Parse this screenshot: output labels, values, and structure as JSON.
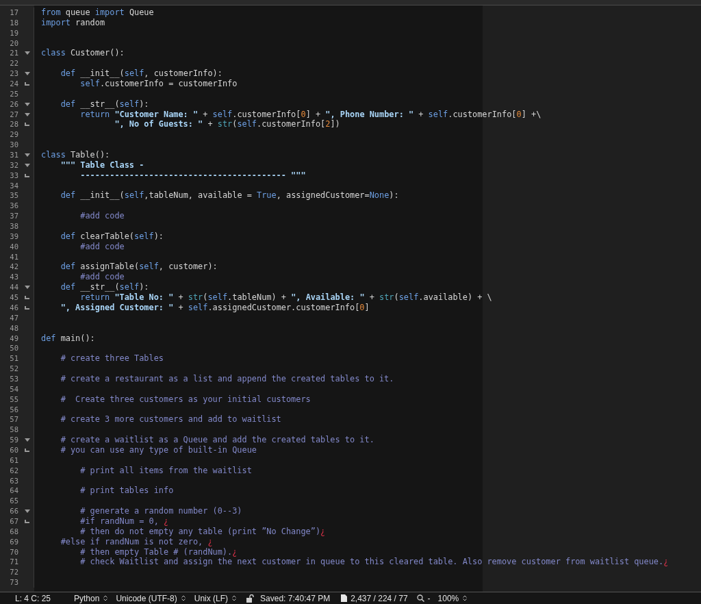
{
  "editor": {
    "lines": [
      {
        "number": "17",
        "tokens": [
          {
            "kind": "keyword",
            "text": "from"
          },
          {
            "kind": "text",
            "text": " queue "
          },
          {
            "kind": "keyword",
            "text": "import"
          },
          {
            "kind": "text",
            "text": " Queue"
          }
        ]
      },
      {
        "number": "18",
        "tokens": [
          {
            "kind": "keyword",
            "text": "import"
          },
          {
            "kind": "text",
            "text": " random"
          }
        ]
      },
      {
        "number": "19"
      },
      {
        "number": "20"
      },
      {
        "number": "21",
        "foldable": true,
        "tokens": [
          {
            "kind": "keyword",
            "text": "class"
          },
          {
            "kind": "text",
            "text": " Customer():"
          }
        ]
      },
      {
        "number": "22"
      },
      {
        "number": "23",
        "foldable": true,
        "tokens": [
          {
            "kind": "keyword",
            "text": "    def"
          },
          {
            "kind": "text",
            "text": " __init__("
          },
          {
            "kind": "keyword",
            "text": "self"
          },
          {
            "kind": "text",
            "text": ", customerInfo):"
          }
        ]
      },
      {
        "number": "24",
        "fold_end": true,
        "tokens": [
          {
            "kind": "keyword",
            "text": "        self"
          },
          {
            "kind": "text",
            "text": ".customerInfo = customerInfo"
          }
        ]
      },
      {
        "number": "25"
      },
      {
        "number": "26",
        "foldable": true,
        "tokens": [
          {
            "kind": "keyword",
            "text": "    def"
          },
          {
            "kind": "text",
            "text": " __str__("
          },
          {
            "kind": "keyword",
            "text": "self"
          },
          {
            "kind": "text",
            "text": "):"
          }
        ]
      },
      {
        "number": "27",
        "foldable": true,
        "tokens": [
          {
            "kind": "keyword",
            "text": "        return "
          },
          {
            "kind": "string",
            "text": "\"Customer Name: \""
          },
          {
            "kind": "text",
            "text": " + "
          },
          {
            "kind": "keyword",
            "text": "self"
          },
          {
            "kind": "text",
            "text": ".customerInfo["
          },
          {
            "kind": "number",
            "text": "0"
          },
          {
            "kind": "text",
            "text": "] + "
          },
          {
            "kind": "string",
            "text": "\", Phone Number: \""
          },
          {
            "kind": "text",
            "text": " + "
          },
          {
            "kind": "keyword",
            "text": "self"
          },
          {
            "kind": "text",
            "text": ".customerInfo["
          },
          {
            "kind": "number",
            "text": "0"
          },
          {
            "kind": "text",
            "text": "] +\\"
          }
        ]
      },
      {
        "number": "28",
        "fold_end": true,
        "tokens": [
          {
            "kind": "string",
            "text": "               \", No of Guests: \""
          },
          {
            "kind": "text",
            "text": " + "
          },
          {
            "kind": "builtin",
            "text": "str"
          },
          {
            "kind": "text",
            "text": "("
          },
          {
            "kind": "keyword",
            "text": "self"
          },
          {
            "kind": "text",
            "text": ".customerInfo["
          },
          {
            "kind": "number",
            "text": "2"
          },
          {
            "kind": "text",
            "text": "])"
          }
        ]
      },
      {
        "number": "29"
      },
      {
        "number": "30"
      },
      {
        "number": "31",
        "foldable": true,
        "tokens": [
          {
            "kind": "keyword",
            "text": "class"
          },
          {
            "kind": "text",
            "text": " Table():"
          }
        ]
      },
      {
        "number": "32",
        "foldable": true,
        "tokens": [
          {
            "kind": "string",
            "text": "    \"\"\" Table Class -"
          }
        ]
      },
      {
        "number": "33",
        "fold_end": true,
        "tokens": [
          {
            "kind": "string",
            "text": "        ------------------------------------------ \"\"\""
          }
        ]
      },
      {
        "number": "34"
      },
      {
        "number": "35",
        "tokens": [
          {
            "kind": "keyword",
            "text": "    def"
          },
          {
            "kind": "text",
            "text": " __init__("
          },
          {
            "kind": "keyword",
            "text": "self"
          },
          {
            "kind": "text",
            "text": ",tableNum, available = "
          },
          {
            "kind": "keyword",
            "text": "True"
          },
          {
            "kind": "text",
            "text": ", assignedCustomer="
          },
          {
            "kind": "keyword",
            "text": "None"
          },
          {
            "kind": "text",
            "text": "):"
          }
        ]
      },
      {
        "number": "36"
      },
      {
        "number": "37",
        "tokens": [
          {
            "kind": "comment",
            "text": "        #add code"
          }
        ]
      },
      {
        "number": "38"
      },
      {
        "number": "39",
        "tokens": [
          {
            "kind": "keyword",
            "text": "    def"
          },
          {
            "kind": "text",
            "text": " clearTable("
          },
          {
            "kind": "keyword",
            "text": "self"
          },
          {
            "kind": "text",
            "text": "):"
          }
        ]
      },
      {
        "number": "40",
        "tokens": [
          {
            "kind": "comment",
            "text": "        #add code"
          }
        ]
      },
      {
        "number": "41"
      },
      {
        "number": "42",
        "tokens": [
          {
            "kind": "keyword",
            "text": "    def"
          },
          {
            "kind": "text",
            "text": " assignTable("
          },
          {
            "kind": "keyword",
            "text": "self"
          },
          {
            "kind": "text",
            "text": ", customer):"
          }
        ]
      },
      {
        "number": "43",
        "tokens": [
          {
            "kind": "comment",
            "text": "        #add code"
          }
        ]
      },
      {
        "number": "44",
        "foldable": true,
        "tokens": [
          {
            "kind": "keyword",
            "text": "    def"
          },
          {
            "kind": "text",
            "text": " __str__("
          },
          {
            "kind": "keyword",
            "text": "self"
          },
          {
            "kind": "text",
            "text": "):"
          }
        ]
      },
      {
        "number": "45",
        "fold_end": true,
        "tokens": [
          {
            "kind": "keyword",
            "text": "        return "
          },
          {
            "kind": "string",
            "text": "\"Table No: \""
          },
          {
            "kind": "text",
            "text": " + "
          },
          {
            "kind": "builtin",
            "text": "str"
          },
          {
            "kind": "text",
            "text": "("
          },
          {
            "kind": "keyword",
            "text": "self"
          },
          {
            "kind": "text",
            "text": ".tableNum) + "
          },
          {
            "kind": "string",
            "text": "\", Available: \""
          },
          {
            "kind": "text",
            "text": " + "
          },
          {
            "kind": "builtin",
            "text": "str"
          },
          {
            "kind": "text",
            "text": "("
          },
          {
            "kind": "keyword",
            "text": "self"
          },
          {
            "kind": "text",
            "text": ".available) + \\"
          }
        ]
      },
      {
        "number": "46",
        "fold_end": true,
        "tokens": [
          {
            "kind": "string",
            "text": "    \", Assigned Customer: \""
          },
          {
            "kind": "text",
            "text": " + "
          },
          {
            "kind": "keyword",
            "text": "self"
          },
          {
            "kind": "text",
            "text": ".assignedCustomer.customerInfo["
          },
          {
            "kind": "number",
            "text": "0"
          },
          {
            "kind": "text",
            "text": "]"
          }
        ]
      },
      {
        "number": "47"
      },
      {
        "number": "48"
      },
      {
        "number": "49",
        "tokens": [
          {
            "kind": "keyword",
            "text": "def"
          },
          {
            "kind": "text",
            "text": " main():"
          }
        ]
      },
      {
        "number": "50"
      },
      {
        "number": "51",
        "tokens": [
          {
            "kind": "comment",
            "text": "    # create three Tables"
          }
        ]
      },
      {
        "number": "52"
      },
      {
        "number": "53",
        "tokens": [
          {
            "kind": "comment",
            "text": "    # create a restaurant as a list and append the created tables to it."
          }
        ]
      },
      {
        "number": "54"
      },
      {
        "number": "55",
        "tokens": [
          {
            "kind": "comment",
            "text": "    #  Create three customers as your initial customers"
          }
        ]
      },
      {
        "number": "56"
      },
      {
        "number": "57",
        "tokens": [
          {
            "kind": "comment",
            "text": "    # create 3 more customers and add to waitlist"
          }
        ]
      },
      {
        "number": "58"
      },
      {
        "number": "59",
        "foldable": true,
        "tokens": [
          {
            "kind": "comment",
            "text": "    # create a waitlist as a Queue and add the created tables to it."
          }
        ]
      },
      {
        "number": "60",
        "fold_end": true,
        "tokens": [
          {
            "kind": "comment",
            "text": "    # you can use any type of built-in Queue"
          }
        ]
      },
      {
        "number": "61"
      },
      {
        "number": "62",
        "tokens": [
          {
            "kind": "comment",
            "text": "        # print all items from the waitlist"
          }
        ]
      },
      {
        "number": "63"
      },
      {
        "number": "64",
        "tokens": [
          {
            "kind": "comment",
            "text": "        # print tables info"
          }
        ]
      },
      {
        "number": "65"
      },
      {
        "number": "66",
        "foldable": true,
        "tokens": [
          {
            "kind": "comment",
            "text": "        # generate a random number (0--3)"
          }
        ]
      },
      {
        "number": "67",
        "fold_end": true,
        "tokens": [
          {
            "kind": "comment",
            "text": "        #if randNum = 0, "
          },
          {
            "kind": "invisible",
            "text": "¿"
          }
        ]
      },
      {
        "number": "68",
        "tokens": [
          {
            "kind": "comment",
            "text": "        # then do not empty any table (print ”No Change”)"
          },
          {
            "kind": "invisible",
            "text": "¿"
          }
        ]
      },
      {
        "number": "69",
        "tokens": [
          {
            "kind": "comment",
            "text": "    #else if randNum is not zero, "
          },
          {
            "kind": "invisible",
            "text": "¿"
          }
        ]
      },
      {
        "number": "70",
        "tokens": [
          {
            "kind": "comment",
            "text": "        # then empty Table # (randNum)."
          },
          {
            "kind": "invisible",
            "text": "¿"
          }
        ]
      },
      {
        "number": "71",
        "tokens": [
          {
            "kind": "comment",
            "text": "        # check Waitlist and assign the next customer in queue to this cleared table. Also remove customer from waitlist queue."
          },
          {
            "kind": "invisible",
            "text": "¿"
          }
        ]
      },
      {
        "number": "72"
      },
      {
        "number": "73"
      }
    ]
  },
  "status_bar": {
    "position": "L: 4 C: 25",
    "language": "Python",
    "encoding": "Unicode (UTF-8)",
    "line_endings": "Unix (LF)",
    "locked": false,
    "saved": "Saved: 7:40:47 PM",
    "counts": "2,437 / 224 / 77",
    "zoom_out": "-",
    "zoom": "100%"
  }
}
